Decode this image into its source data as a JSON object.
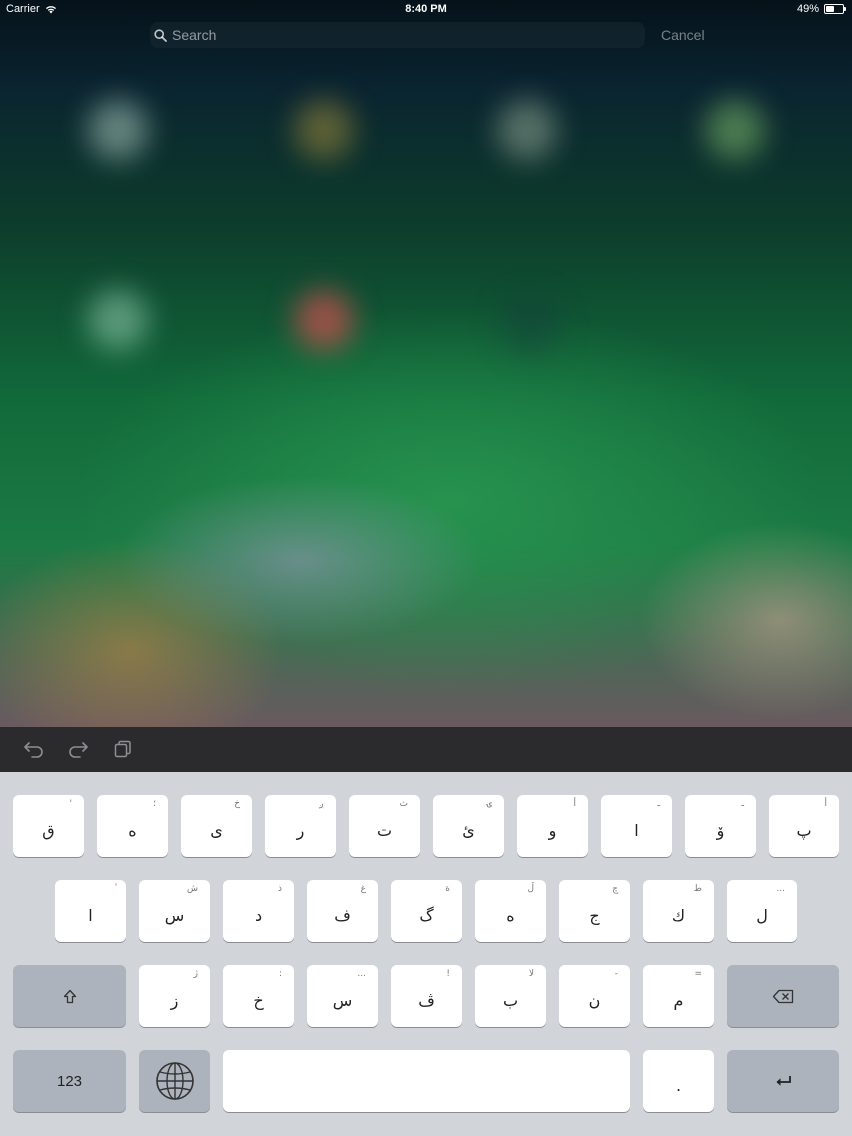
{
  "status_bar": {
    "carrier": "Carrier",
    "time": "8:40 PM",
    "battery": "49%",
    "battery_level": 0.49
  },
  "search": {
    "placeholder": "Search",
    "value": "",
    "cancel_label": "Cancel"
  },
  "toolbar": {
    "icons": [
      "undo-icon",
      "redo-icon",
      "paste-icon"
    ]
  },
  "keyboard": {
    "rows": [
      [
        {
          "char": "ق",
          "hint": "'"
        },
        {
          "char": "ه",
          "hint": "؛"
        },
        {
          "char": "ى",
          "hint": "خ"
        },
        {
          "char": "ر",
          "hint": "ږ"
        },
        {
          "char": "ت",
          "hint": "ث"
        },
        {
          "char": "ئ",
          "hint": "ۍ"
        },
        {
          "char": "و",
          "hint": "أ"
        },
        {
          "char": "ا",
          "hint": "ـ"
        },
        {
          "char": "ۆ",
          "hint": "ـ"
        },
        {
          "char": "پ",
          "hint": "أ"
        }
      ],
      [
        {
          "char": "ا",
          "hint": "ٔ"
        },
        {
          "char": "س",
          "hint": "ش"
        },
        {
          "char": "د",
          "hint": "ذ"
        },
        {
          "char": "ف",
          "hint": "غ"
        },
        {
          "char": "گ",
          "hint": "ة"
        },
        {
          "char": "ه",
          "hint": "ڵ"
        },
        {
          "char": "ج",
          "hint": "چ"
        },
        {
          "char": "ك",
          "hint": "ط"
        },
        {
          "char": "ل",
          "hint": "..."
        }
      ],
      [
        {
          "char": "ز",
          "hint": "ژ"
        },
        {
          "char": "خ",
          "hint": ":"
        },
        {
          "char": "س",
          "hint": "..."
        },
        {
          "char": "ڤ",
          "hint": "!"
        },
        {
          "char": "ب",
          "hint": "لا"
        },
        {
          "char": "ن",
          "hint": "-"
        },
        {
          "char": "م",
          "hint": "="
        }
      ]
    ],
    "numbers_label": "123",
    "period_label": "."
  }
}
